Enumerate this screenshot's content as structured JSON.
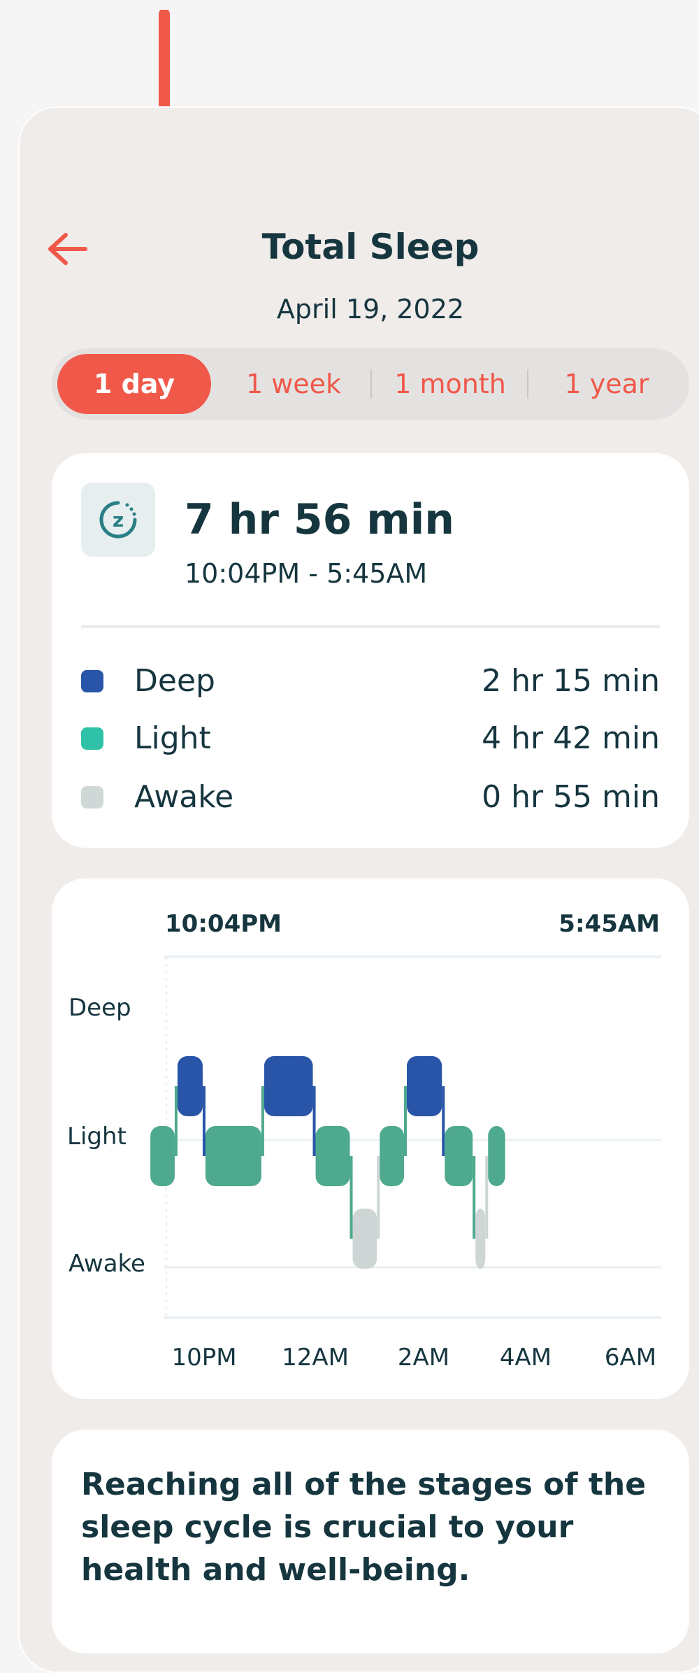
{
  "header": {
    "title": "Total Sleep",
    "date": "April 19, 2022",
    "back_icon": "arrow-left-icon"
  },
  "range_tabs": [
    {
      "label": "1 day",
      "active": true
    },
    {
      "label": "1 week",
      "active": false
    },
    {
      "label": "1 month",
      "active": false
    },
    {
      "label": "1 year",
      "active": false
    }
  ],
  "summary": {
    "icon": "sleep-zz-icon",
    "duration": "7 hr 56 min",
    "time_range": "10:04PM - 5:45AM",
    "stages": [
      {
        "name": "Deep",
        "value": "2 hr 15 min",
        "color": "#2955a8"
      },
      {
        "name": "Light",
        "value": "4 hr 42 min",
        "color": "#2fc2a8"
      },
      {
        "name": "Awake",
        "value": "0 hr 55 min",
        "color": "#cfd8d6"
      }
    ]
  },
  "chart_data": {
    "type": "bar",
    "start_label": "10:04PM",
    "end_label": "5:45AM",
    "y_categories": [
      "Deep",
      "Light",
      "Awake"
    ],
    "x_ticks": [
      "10PM",
      "12AM",
      "2AM",
      "4AM",
      "6AM"
    ],
    "colors": {
      "Deep": "#2955a8",
      "Light": "#4ea98e",
      "Awake": "#cdd6d4"
    },
    "segments": [
      {
        "stage": "Light",
        "start": "22:04",
        "end": "22:34"
      },
      {
        "stage": "Deep",
        "start": "22:34",
        "end": "23:05"
      },
      {
        "stage": "Light",
        "start": "23:05",
        "end": "00:10"
      },
      {
        "stage": "Deep",
        "start": "00:10",
        "end": "01:07"
      },
      {
        "stage": "Light",
        "start": "01:07",
        "end": "01:48"
      },
      {
        "stage": "Awake",
        "start": "01:48",
        "end": "02:18"
      },
      {
        "stage": "Light",
        "start": "02:18",
        "end": "02:48"
      },
      {
        "stage": "Deep",
        "start": "02:48",
        "end": "03:30"
      },
      {
        "stage": "Light",
        "start": "03:30",
        "end": "04:04"
      },
      {
        "stage": "Awake",
        "start": "04:04",
        "end": "04:18"
      },
      {
        "stage": "Light",
        "start": "04:18",
        "end": "04:40"
      }
    ]
  },
  "info": {
    "text": "Reaching all of the stages of the sleep cycle is crucial to your health and well-being."
  },
  "annotation": {
    "icon": "down-arrow-icon",
    "color": "#f0584a"
  }
}
